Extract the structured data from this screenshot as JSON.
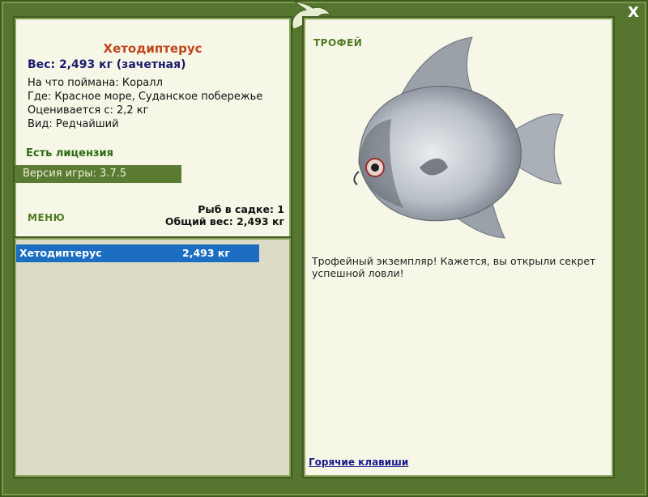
{
  "fish": {
    "name": "Хетодиптерус",
    "weight_line": "Вес: 2,493 кг (зачетная)",
    "bait": "На что поймана: Коралл",
    "place": "Где: Красное море, Суданское побережье",
    "rated_from": "Оценивается с: 2,2 кг",
    "kind": "Вид: Редчайший"
  },
  "license": "Есть лицензия",
  "version": "Версия игры: 3.7.5",
  "menu_label": "МЕНЮ",
  "keepnet": {
    "count": "Рыб в садке: 1",
    "total": "Общий вес: 2,493 кг"
  },
  "list": [
    {
      "name": "Хетодиптерус",
      "weight": "2,493 кг"
    }
  ],
  "trophy": {
    "label": "ТРОФЕЙ",
    "description": "Трофейный экземпляр! Кажется, вы открыли секрет успешной ловли!"
  },
  "hotkeys_label": "Горячие клавиши",
  "close_label": "X",
  "colors": {
    "frame": "#56752e",
    "panel": "#f7f7e8",
    "title": "#c0461b",
    "selection": "#1b6ec2",
    "accent_green": "#4f7a22"
  },
  "icons": {
    "logo": "dragon-logo-icon",
    "close": "close-icon"
  }
}
